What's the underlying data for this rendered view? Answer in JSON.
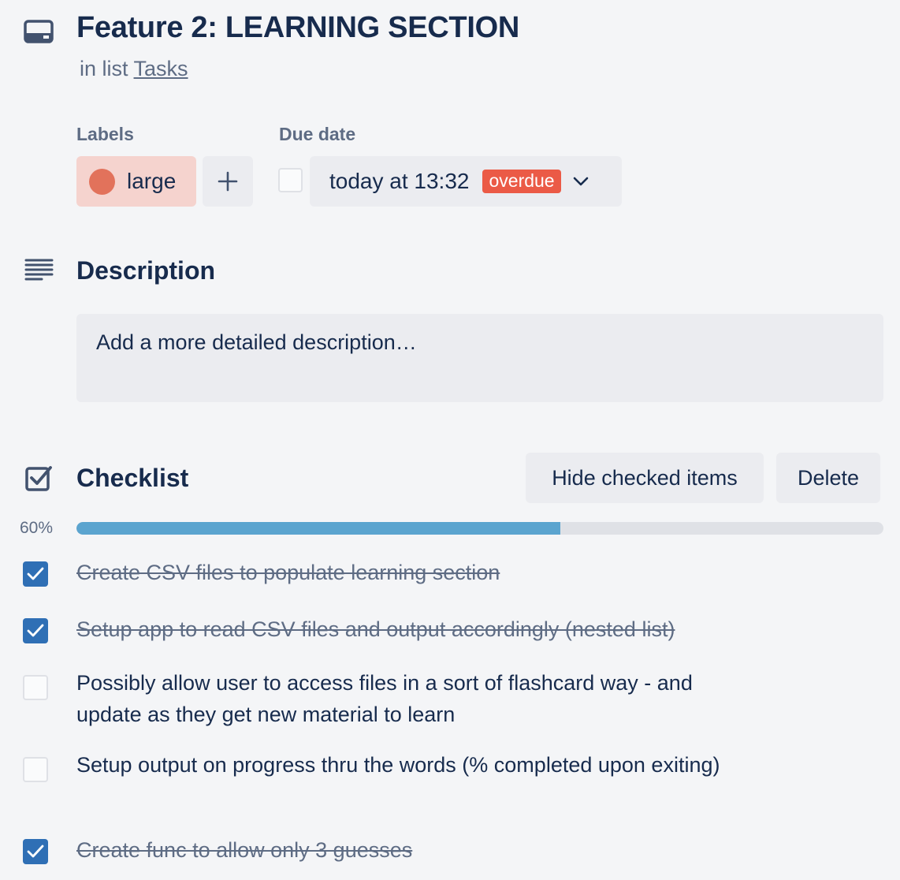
{
  "card": {
    "title": "Feature 2: LEARNING SECTION",
    "in_list_prefix": "in list",
    "list_name": "Tasks"
  },
  "labels": {
    "heading": "Labels",
    "items": [
      {
        "text": "large",
        "color": "#e2725b"
      }
    ]
  },
  "due_date": {
    "heading": "Due date",
    "text": "today at 13:32",
    "badge": "overdue",
    "badge_color": "#eb5a46",
    "completed": false
  },
  "description": {
    "heading": "Description",
    "placeholder": "Add a more detailed description…"
  },
  "checklist": {
    "title": "Checklist",
    "hide_label": "Hide checked items",
    "delete_label": "Delete",
    "progress_text": "60%",
    "progress": 0.6,
    "items": [
      {
        "text": "Create CSV files to populate learning section",
        "checked": true
      },
      {
        "text": "Setup app to read CSV files and output accordingly (nested list)",
        "checked": true
      },
      {
        "text": "Possibly allow user to access files in a sort of flashcard way - and update as they get new material to learn",
        "checked": false
      },
      {
        "text": "Setup output on progress thru the words (% completed upon exiting)",
        "checked": false
      },
      {
        "text": "Create func to allow only 3 guesses",
        "checked": true
      }
    ]
  },
  "icons": [
    "card-icon",
    "plus-icon",
    "chevron-down-icon",
    "description-icon",
    "checklist-icon",
    "checkmark-icon"
  ]
}
